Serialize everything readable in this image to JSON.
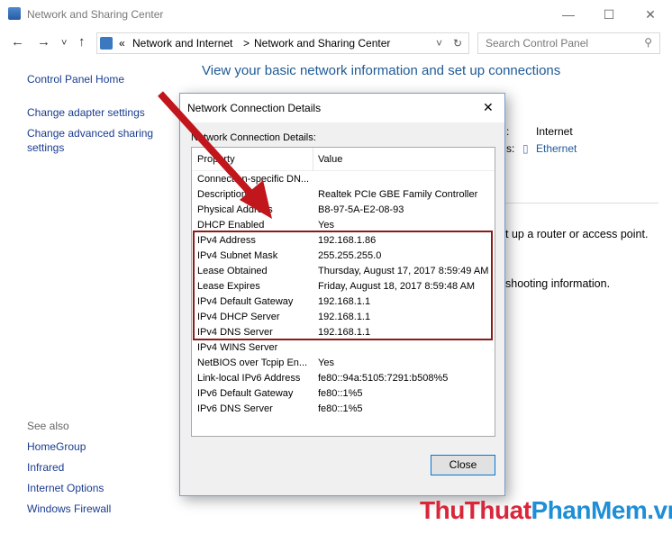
{
  "window": {
    "title": "Network and Sharing Center",
    "minimize": "—",
    "maximize": "☐",
    "close": "✕"
  },
  "nav": {
    "back": "←",
    "forward": "→",
    "dropdown": "˅",
    "up": "↑"
  },
  "address": {
    "prefix": "«",
    "crumbs": [
      "Network and Internet",
      "Network and Sharing Center"
    ],
    "sep": ">",
    "refresh": "↻"
  },
  "search": {
    "placeholder": "Search Control Panel"
  },
  "sidebar": {
    "home": "Control Panel Home",
    "items": [
      "Change adapter settings",
      "Change advanced sharing settings"
    ],
    "see_also": "See also",
    "see_also_items": [
      "HomeGroup",
      "Infrared",
      "Internet Options",
      "Windows Firewall"
    ]
  },
  "main": {
    "heading": "View your basic network information and set up connections",
    "access_type_label": ":",
    "access_type": "Internet",
    "connections_label": "s:",
    "connection": "Ethernet",
    "setup_text": "t up a router or access point.",
    "troubleshoot_text": "shooting information."
  },
  "dialog": {
    "title": "Network Connection Details",
    "close": "✕",
    "section_label": "Network Connection Details:",
    "col_property": "Property",
    "col_value": "Value",
    "close_button": "Close",
    "rows": [
      {
        "p": "Connection-specific DN...",
        "v": ""
      },
      {
        "p": "Description",
        "v": "Realtek PCIe GBE Family Controller"
      },
      {
        "p": "Physical Address",
        "v": "B8-97-5A-E2-08-93"
      },
      {
        "p": "DHCP Enabled",
        "v": "Yes"
      },
      {
        "p": "IPv4 Address",
        "v": "192.168.1.86"
      },
      {
        "p": "IPv4 Subnet Mask",
        "v": "255.255.255.0"
      },
      {
        "p": "Lease Obtained",
        "v": "Thursday, August 17, 2017 8:59:49 AM"
      },
      {
        "p": "Lease Expires",
        "v": "Friday, August 18, 2017 8:59:48 AM"
      },
      {
        "p": "IPv4 Default Gateway",
        "v": "192.168.1.1"
      },
      {
        "p": "IPv4 DHCP Server",
        "v": "192.168.1.1"
      },
      {
        "p": "IPv4 DNS Server",
        "v": "192.168.1.1"
      },
      {
        "p": "IPv4 WINS Server",
        "v": ""
      },
      {
        "p": "NetBIOS over Tcpip En...",
        "v": "Yes"
      },
      {
        "p": "Link-local IPv6 Address",
        "v": "fe80::94a:5105:7291:b508%5"
      },
      {
        "p": "IPv6 Default Gateway",
        "v": "fe80::1%5"
      },
      {
        "p": "IPv6 DNS Server",
        "v": "fe80::1%5"
      }
    ]
  },
  "watermark": {
    "part1": "ThuThuat",
    "part2": "PhanMem",
    "part3": ".vn"
  },
  "colors": {
    "annotation_red": "#c0161c",
    "link": "#1a3c8f",
    "heading": "#1e5a96",
    "wm_red": "#d8263a",
    "wm_blue": "#1e8fd6"
  }
}
